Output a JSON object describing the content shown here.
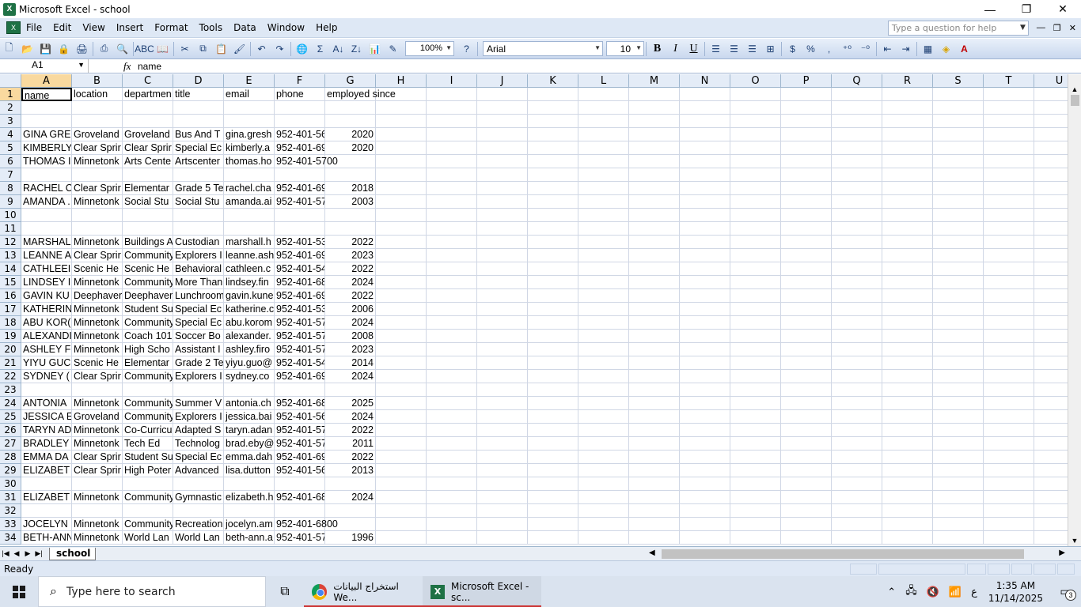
{
  "window": {
    "title": "Microsoft Excel - school",
    "minimize": "—",
    "restore": "❐",
    "close": "✕"
  },
  "menu": {
    "items": [
      "File",
      "Edit",
      "View",
      "Insert",
      "Format",
      "Tools",
      "Data",
      "Window",
      "Help"
    ],
    "help_placeholder": "Type a question for help"
  },
  "toolbar": {
    "zoom": "100%",
    "font": "Arial",
    "font_size": "10",
    "bold": "B",
    "italic": "I",
    "underline": "U",
    "currency": "$",
    "percent": "%",
    "comma": ","
  },
  "formula_bar": {
    "name_box": "A1",
    "fx": "fx",
    "value": "name"
  },
  "columns": [
    "A",
    "B",
    "C",
    "D",
    "E",
    "F",
    "G",
    "H",
    "I",
    "J",
    "K",
    "L",
    "M",
    "N",
    "O",
    "P",
    "Q",
    "R",
    "S",
    "T",
    "U"
  ],
  "rows": [
    [
      "name",
      "location",
      "departmen",
      "title",
      "email",
      "phone",
      "employed since"
    ],
    [],
    [],
    [
      "GINA GRE",
      "Groveland",
      "Groveland",
      "Bus And T",
      "gina.gresh",
      "952-401-56",
      "2020"
    ],
    [
      "KIMBERLY",
      "Clear Sprir",
      "Clear Sprir",
      "Special Ec",
      "kimberly.a",
      "952-401-69",
      "2020"
    ],
    [
      "THOMAS I",
      "Minnetonk",
      "Arts Cente",
      "Artscenter",
      "thomas.ho",
      "952-401-5700",
      ""
    ],
    [],
    [
      "RACHEL C",
      "Clear Sprir",
      "Elementar",
      "Grade 5 Te",
      "rachel.cha",
      "952-401-69",
      "2018"
    ],
    [
      "AMANDA .",
      "Minnetonk",
      "Social Stu",
      "Social Stu",
      "amanda.ai",
      "952-401-57",
      "2003"
    ],
    [],
    [],
    [
      "MARSHAL",
      "Minnetonk",
      "Buildings A",
      "Custodian",
      "marshall.h",
      "952-401-53",
      "2022"
    ],
    [
      "LEANNE A",
      "Clear Sprir",
      "Community",
      "Explorers I",
      "leanne.ash",
      "952-401-69",
      "2023"
    ],
    [
      "CATHLEEI",
      "Scenic He",
      "Scenic He",
      "Behavioral",
      "cathleen.c",
      "952-401-54",
      "2022"
    ],
    [
      "LINDSEY I",
      "Minnetonk",
      "Community",
      "More Than",
      "lindsey.fin",
      "952-401-68",
      "2024"
    ],
    [
      "GAVIN KU",
      "Deephaver",
      "Deephaver",
      "Lunchroom",
      "gavin.kune",
      "952-401-69",
      "2022"
    ],
    [
      "KATHERIN",
      "Minnetonk",
      "Student Su",
      "Special Ec",
      "katherine.c",
      "952-401-53",
      "2006"
    ],
    [
      "ABU KOR(",
      "Minnetonk",
      "Community",
      "Special Ec",
      "abu.korom",
      "952-401-57",
      "2024"
    ],
    [
      "ALEXANDI",
      "Minnetonk",
      "Coach 101",
      "Soccer Bo",
      "alexander.",
      "952-401-57",
      "2008"
    ],
    [
      "ASHLEY F",
      "Minnetonk",
      "High Scho",
      "Assistant I",
      "ashley.firo",
      "952-401-57",
      "2023"
    ],
    [
      "YIYU GUC",
      "Scenic He",
      "Elementar",
      "Grade 2 Te",
      "yiyu.guo@",
      "952-401-54",
      "2014"
    ],
    [
      "SYDNEY (",
      "Clear Sprir",
      "Community",
      "Explorers I",
      "sydney.co",
      "952-401-69",
      "2024"
    ],
    [],
    [
      "ANTONIA",
      "Minnetonk",
      "Community",
      "Summer V",
      "antonia.ch",
      "952-401-68",
      "2025"
    ],
    [
      "JESSICA E",
      "Groveland",
      "Community",
      "Explorers I",
      "jessica.bai",
      "952-401-56",
      "2024"
    ],
    [
      "TARYN AD",
      "Minnetonk",
      "Co-Curricu",
      "Adapted S",
      "taryn.adan",
      "952-401-57",
      "2022"
    ],
    [
      "BRADLEY",
      "Minnetonk",
      "Tech Ed",
      "Technolog",
      "brad.eby@",
      "952-401-57",
      "2011"
    ],
    [
      "EMMA DA",
      "Clear Sprir",
      "Student Su",
      "Special Ec",
      "emma.dah",
      "952-401-69",
      "2022"
    ],
    [
      "ELIZABET",
      "Clear Sprir",
      "High Poter",
      "Advanced",
      "lisa.dutton",
      "952-401-56",
      "2013"
    ],
    [],
    [
      "ELIZABET",
      "Minnetonk",
      "Community",
      "Gymnastic",
      "elizabeth.h",
      "952-401-68",
      "2024"
    ],
    [],
    [
      "JOCELYN",
      "Minnetonk",
      "Community",
      "Recreation",
      "jocelyn.am",
      "952-401-6800",
      ""
    ],
    [
      "BETH-ANN",
      "Minnetonk",
      "World Lan",
      "World Lan",
      "beth-ann.a",
      "952-401-57",
      "1996"
    ]
  ],
  "sheet_tab": "school",
  "status": "Ready",
  "taskbar": {
    "search_placeholder": "Type here to search",
    "chrome_label": "استخراج البيانات  We...",
    "excel_label": "Microsoft Excel - sc...",
    "time": "1:35 AM",
    "date": "11/14/2025",
    "lang": "ع",
    "notifications": "3"
  }
}
